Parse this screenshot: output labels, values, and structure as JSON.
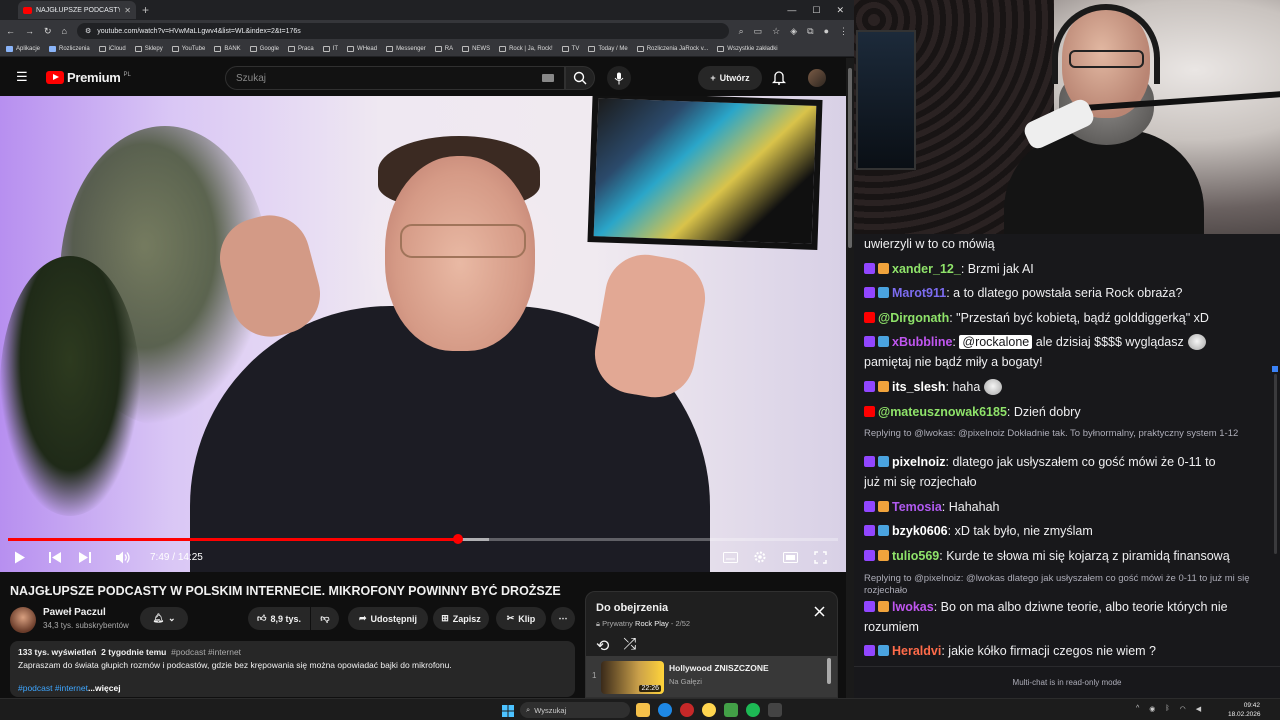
{
  "browser": {
    "tab_title": "NAJGŁUPSZE PODCASTY W...",
    "url": "youtube.com/watch?v=HVwMaLLgwv4&list=WL&index=2&t=176s",
    "bookmarks": [
      "Aplikacje",
      "Rozliczenia",
      "iCloud",
      "Sklepy",
      "YouTube",
      "BANK",
      "Google",
      "Praca",
      "IT",
      "WHead",
      "Messenger",
      "RA",
      "NEWS",
      "Rock | Ja, Rock!",
      "TV",
      "Today / Me",
      "Rozliczenia JaRock v...",
      "Wszystkie zakładki"
    ]
  },
  "youtube": {
    "logo": "Premium",
    "logo_region": "PL",
    "search_placeholder": "Szukaj",
    "create_label": "Utwórz"
  },
  "player": {
    "time_current": "7:49",
    "time_total": "14:25",
    "progress_fraction": 0.542,
    "buffered_fraction": 0.58
  },
  "video": {
    "title": "NAJGŁUPSZE PODCASTY W POLSKIM INTERNECIE. MIKROFONY POWINNY BYĆ DROŻSZE",
    "channel": "Paweł Paczul",
    "subscribers": "34,3 tys. subskrybentów",
    "likes": "8,9 tys.",
    "share": "Udostępnij",
    "save": "Zapisz",
    "clip": "Klip",
    "views": "133 tys. wyświetleń",
    "age": "2 tygodnie temu",
    "tags": "#podcast #internet",
    "description": "Zapraszam do świata głupich rozmów i podcastów, gdzie bez krępowania się można opowiadać bajki do mikrofonu.",
    "hashtags": "#podcast #internet",
    "more": "...więcej"
  },
  "playlist": {
    "title": "Do obejrzenia",
    "privacy": "Prywatny",
    "owner": "Rock Play",
    "position": "2/52",
    "items": [
      {
        "index": "1",
        "title": "Hollywood ZNISZCZONE",
        "channel": "Na Gałęzi",
        "duration": "22:26"
      }
    ]
  },
  "chat": {
    "messages": [
      {
        "user": "",
        "text": "uwierzyli w to co mówią",
        "platform": "",
        "color": "#efeff1"
      },
      {
        "user": "xander_12_",
        "text": "Brzmi jak AI",
        "platform": "twitch",
        "color": "#8fe36a"
      },
      {
        "user": "Marot911",
        "text": "a to dlatego powstała seria Rock obraża?",
        "platform": "twitch",
        "color": "#7c6cf0"
      },
      {
        "user": "@Dirgonath",
        "text": "\"Przestań być kobietą, bądź golddiggerką\" xD",
        "platform": "youtube",
        "color": "#8fe36a"
      },
      {
        "user": "xBubbline",
        "mention": "@rockalone",
        "text": "ale dzisiaj $$$$ wyglądasz",
        "text2": "pamiętaj nie bądź miły a bogaty!",
        "platform": "twitch",
        "color": "#c056f0"
      },
      {
        "user": "its_slesh",
        "text": "haha",
        "platform": "twitch",
        "color": "#ffffff"
      },
      {
        "user": "@mateusznowak6185",
        "text": "Dzień dobry",
        "platform": "youtube",
        "color": "#8fe36a"
      },
      {
        "reply": "Replying to @lwokas: @pixelnoiz Dokładnie tak. To byłnormalny, praktyczny system 1-12"
      },
      {
        "user": "pixelnoiz",
        "text": "dlatego jak usłyszałem co gość mówi że 0-11 to",
        "text2": "już mi się rozjechało",
        "platform": "twitch",
        "color": "#ffffff"
      },
      {
        "user": "Temosia",
        "text": "Hahahah",
        "platform": "twitch",
        "color": "#b05af0"
      },
      {
        "user": "bzyk0606",
        "text": "xD tak było, nie zmyślam",
        "platform": "twitch",
        "color": "#ffffff"
      },
      {
        "user": "tulio569",
        "text": "Kurde te słowa mi się kojarzą z piramidą finansową",
        "platform": "twitch",
        "color": "#8fe36a"
      },
      {
        "reply": "Replying to @pixelnoiz: @lwokas dlatego jak usłyszałem co gość mówi że 0-11 to już mi się rozjechało"
      },
      {
        "user": "lwokas",
        "text": "Bo on ma albo dziwne teorie, albo teorie których nie",
        "text2": "rozumiem",
        "platform": "twitch",
        "color": "#c056f0"
      },
      {
        "user": "Heraldvi",
        "text": "jakie kółko firmacji czegos nie wiem ?",
        "platform": "twitch",
        "color": "#ff6b4a"
      }
    ],
    "readonly": "Multi-chat is in read-only mode"
  },
  "taskbar": {
    "search": "Wyszukaj",
    "time": "09:42",
    "date": "18.02.2026"
  }
}
